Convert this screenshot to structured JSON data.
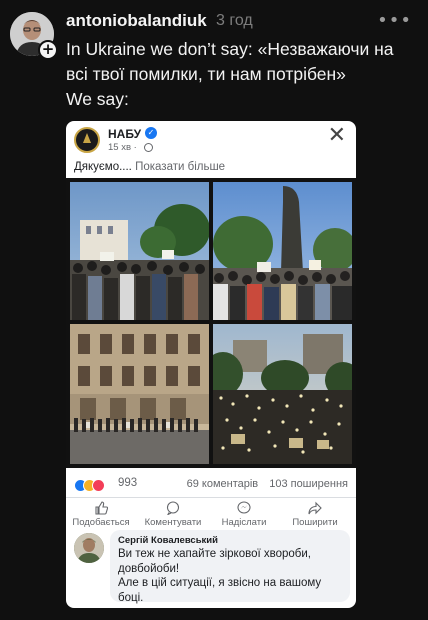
{
  "post": {
    "username": "antoniobalandiuk",
    "time": "3 год",
    "more_icon": "more-dots-icon",
    "caption_lines": [
      "In Ukraine we don’t say: «Незважаючи на",
      "всі твої помилки, ти нам потрібен»",
      "We say:"
    ]
  },
  "embedded_post": {
    "page_name": "НАБУ",
    "time": "15 хв ·",
    "text": "Дякуємо....",
    "more_link": "Показати більше",
    "reaction_count": "993",
    "comments": "69 коментарів",
    "shares": "103 поширення",
    "actions": [
      "Подобається",
      "Коментувати",
      "Надіслати",
      "Поширити"
    ],
    "comment": {
      "author": "Сергій Ковалевський",
      "lines": [
        "Ви теж не хапайте зіркової хвороби,",
        "довбойоби!",
        "Але в цій ситуації, я звісно на вашому",
        "боці."
      ]
    }
  },
  "colors": {
    "background": "#101010",
    "facebook_blue": "#1877f2",
    "muted": "#65676b"
  }
}
